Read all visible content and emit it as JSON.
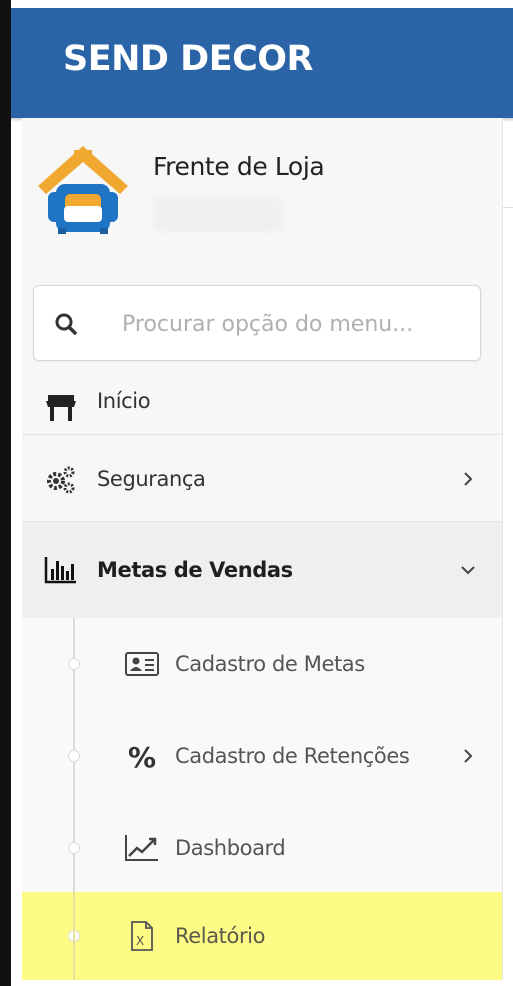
{
  "app": {
    "brand": "SEND DECOR",
    "colors": {
      "header_bg": "#2a64a7",
      "highlight": "#fdfa85",
      "logo_orange": "#f0a830",
      "logo_blue": "#1f74c4"
    }
  },
  "profile": {
    "store_name": "Frente de Loja",
    "logo_icon": "armchair-house-logo"
  },
  "search": {
    "placeholder": "Procurar opção do menu...",
    "value": ""
  },
  "menu": {
    "items": [
      {
        "label": "Início",
        "icon": "store-icon",
        "expanded": false
      },
      {
        "label": "Segurança",
        "icon": "gears-icon",
        "has_children": true,
        "expanded": false
      },
      {
        "label": "Metas de Vendas",
        "icon": "bar-chart-icon",
        "has_children": true,
        "expanded": true,
        "submenu": [
          {
            "label": "Cadastro de Metas",
            "icon": "id-card-icon"
          },
          {
            "label": "Cadastro de Retenções",
            "icon": "percent-icon",
            "has_children": true
          },
          {
            "label": "Dashboard",
            "icon": "line-chart-icon"
          },
          {
            "label": "Relatório",
            "icon": "excel-file-icon",
            "highlighted": true
          }
        ]
      }
    ]
  }
}
